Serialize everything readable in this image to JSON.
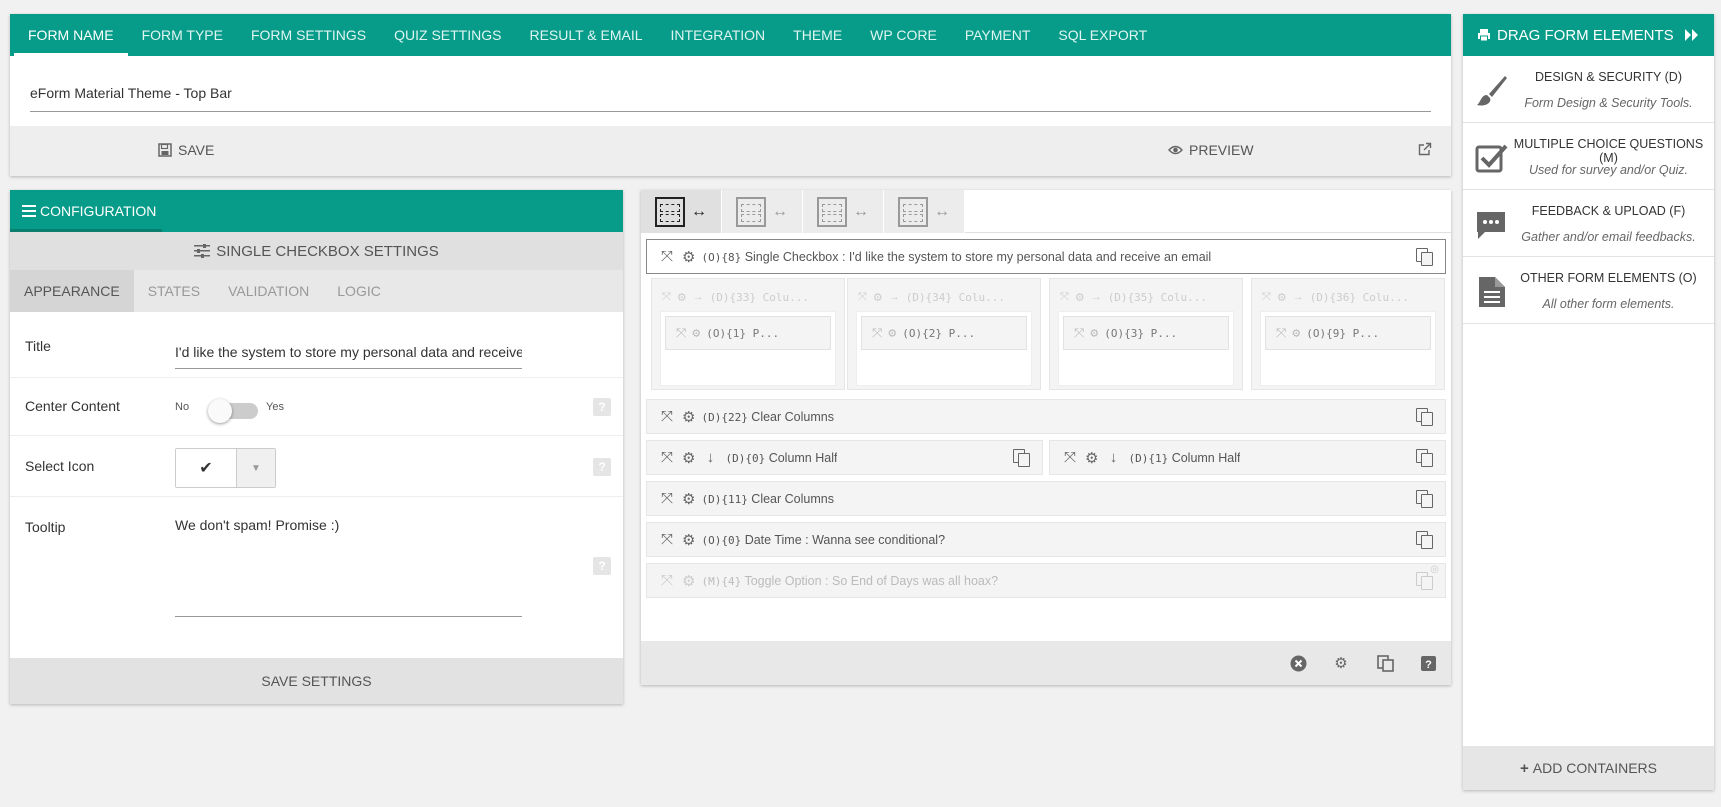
{
  "top_tabs": [
    "FORM NAME",
    "FORM TYPE",
    "FORM SETTINGS",
    "QUIZ SETTINGS",
    "RESULT & EMAIL",
    "INTEGRATION",
    "THEME",
    "WP CORE",
    "PAYMENT",
    "SQL EXPORT"
  ],
  "form_name": "eForm Material Theme - Top Bar",
  "actions": {
    "save": "SAVE",
    "preview": "PREVIEW"
  },
  "right_panel": {
    "title": "DRAG FORM ELEMENTS",
    "cards": [
      {
        "title": "DESIGN & SECURITY (D)",
        "subtitle": "Form Design & Security Tools.",
        "icon": "paintbrush-icon"
      },
      {
        "title": "MULTIPLE CHOICE QUESTIONS (M)",
        "subtitle": "Used for survey and/or Quiz.",
        "icon": "checkbox-icon"
      },
      {
        "title": "FEEDBACK & UPLOAD (F)",
        "subtitle": "Gather and/or email feedbacks.",
        "icon": "comment-icon"
      },
      {
        "title": "OTHER FORM ELEMENTS (O)",
        "subtitle": "All other form elements.",
        "icon": "document-icon"
      }
    ],
    "add_containers": "ADD CONTAINERS"
  },
  "config": {
    "header": "CONFIGURATION",
    "settings_title": "SINGLE CHECKBOX SETTINGS",
    "tabs": [
      "APPEARANCE",
      "STATES",
      "VALIDATION",
      "LOGIC"
    ],
    "fields": {
      "title_label": "Title",
      "title_value": "I'd like the system to store my personal data and receive an email",
      "center_label": "Center Content",
      "center_no": "No",
      "center_yes": "Yes",
      "center_value": false,
      "icon_label": "Select Icon",
      "icon_value": "✔",
      "tooltip_label": "Tooltip",
      "tooltip_value": "We don't spam! Promise :)"
    },
    "save_settings": "SAVE SETTINGS"
  },
  "builder": {
    "elements": {
      "single_checkbox": {
        "code": "(O){8}",
        "label": "Single Checkbox : I'd like the system to store my personal data and receive an email"
      },
      "columns": [
        {
          "code": "(D){33}",
          "label": "Colu...",
          "sub": "(O){1} P..."
        },
        {
          "code": "(D){34}",
          "label": "Colu...",
          "sub": "(O){2} P..."
        },
        {
          "code": "(D){35}",
          "label": "Colu...",
          "sub": "(O){3} P..."
        },
        {
          "code": "(D){36}",
          "label": "Colu...",
          "sub": "(O){9} P..."
        }
      ],
      "clear1": {
        "code": "(D){22}",
        "label": "Clear Columns"
      },
      "half_left": {
        "code": "(D){0}",
        "label": "Column Half"
      },
      "half_right": {
        "code": "(D){1}",
        "label": "Column Half"
      },
      "clear2": {
        "code": "(D){11}",
        "label": "Clear Columns"
      },
      "datetime": {
        "code": "(O){0}",
        "label": "Date Time : Wanna see conditional?"
      },
      "toggle": {
        "code": "(M){4}",
        "label": "Toggle Option : So End of Days was all hoax?"
      }
    }
  }
}
